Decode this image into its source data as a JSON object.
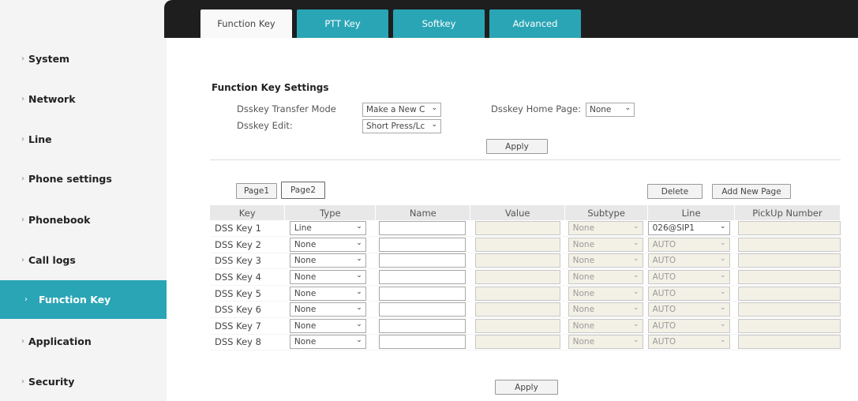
{
  "sidebar": {
    "items": [
      {
        "label": "System"
      },
      {
        "label": "Network"
      },
      {
        "label": "Line"
      },
      {
        "label": "Phone settings"
      },
      {
        "label": "Phonebook"
      },
      {
        "label": "Call logs"
      },
      {
        "label": "Function Key"
      },
      {
        "label": "Application"
      },
      {
        "label": "Security"
      }
    ],
    "arrow_glyph": "›",
    "active_index": 6
  },
  "tabs": [
    {
      "label": "Function Key"
    },
    {
      "label": "PTT Key"
    },
    {
      "label": "Softkey"
    },
    {
      "label": "Advanced"
    }
  ],
  "settings": {
    "title": "Function Key Settings",
    "transfer_mode_label": "Dsskey Transfer Mode",
    "transfer_mode_value": "Make a New C",
    "home_page_label": "Dsskey Home Page:",
    "home_page_value": "None",
    "edit_label": "Dsskey Edit:",
    "edit_value": "Short Press/Lc",
    "apply_label": "Apply"
  },
  "pages": {
    "page1_label": "Page1",
    "page2_label": "Page2",
    "delete_label": "Delete",
    "add_page_label": "Add New Page"
  },
  "table": {
    "headers": {
      "key": "Key",
      "type": "Type",
      "name": "Name",
      "value": "Value",
      "subtype": "Subtype",
      "line": "Line",
      "pickup": "PickUp Number"
    },
    "rows": [
      {
        "key": "DSS Key 1",
        "type": "Line",
        "subtype": "None",
        "line": "026@SIP1"
      },
      {
        "key": "DSS Key 2",
        "type": "None",
        "subtype": "None",
        "line": "AUTO"
      },
      {
        "key": "DSS Key 3",
        "type": "None",
        "subtype": "None",
        "line": "AUTO"
      },
      {
        "key": "DSS Key 4",
        "type": "None",
        "subtype": "None",
        "line": "AUTO"
      },
      {
        "key": "DSS Key 5",
        "type": "None",
        "subtype": "None",
        "line": "AUTO"
      },
      {
        "key": "DSS Key 6",
        "type": "None",
        "subtype": "None",
        "line": "AUTO"
      },
      {
        "key": "DSS Key 7",
        "type": "None",
        "subtype": "None",
        "line": "AUTO"
      },
      {
        "key": "DSS Key 8",
        "type": "None",
        "subtype": "None",
        "line": "AUTO"
      }
    ],
    "apply_label": "Apply"
  },
  "colors": {
    "accent": "#2aa5b5",
    "topbar": "#1e1e1e",
    "sidebar_bg": "#f4f4f4",
    "disabled_bg": "#f3f1e6"
  },
  "icons": {
    "dropdown": "chevron-down-icon",
    "sidebar_arrow": "chevron-right-icon"
  }
}
